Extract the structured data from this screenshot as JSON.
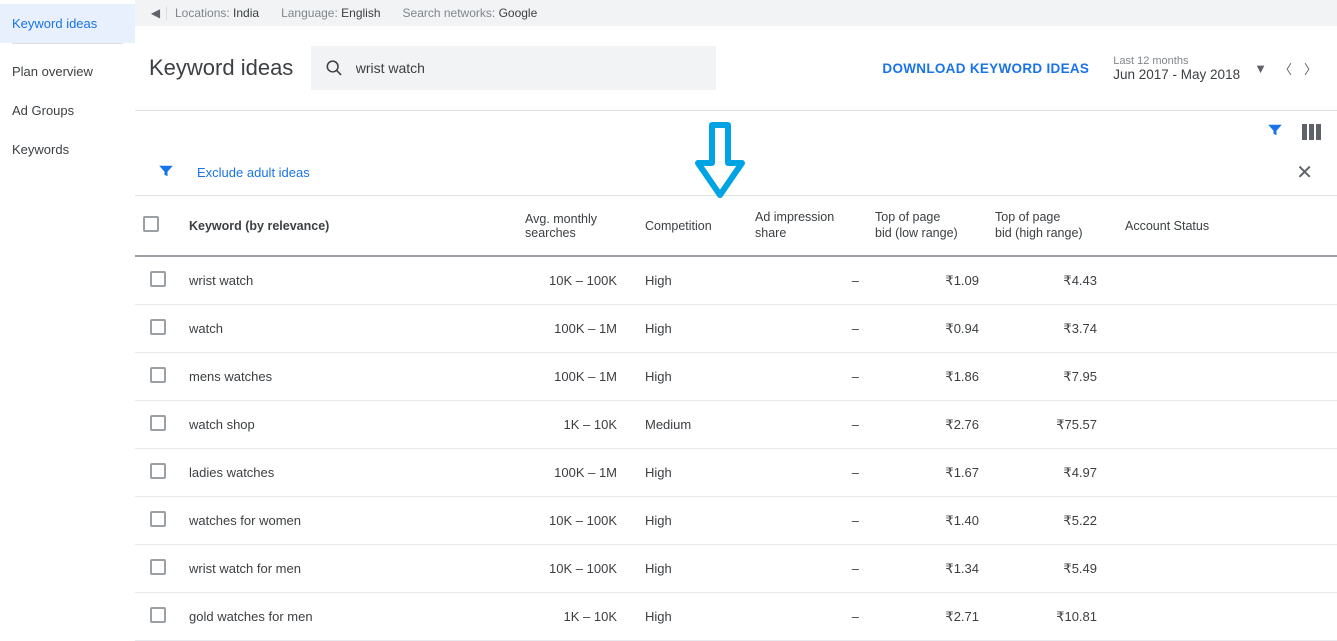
{
  "sidebar": {
    "items": [
      {
        "label": "Keyword ideas"
      },
      {
        "label": "Plan overview"
      },
      {
        "label": "Ad Groups"
      },
      {
        "label": "Keywords"
      }
    ]
  },
  "topbar": {
    "locations_label": "Locations:",
    "locations_value": "India",
    "language_label": "Language:",
    "language_value": "English",
    "networks_label": "Search networks:",
    "networks_value": "Google"
  },
  "header": {
    "title": "Keyword ideas",
    "search_value": "wrist watch",
    "download_label": "DOWNLOAD KEYWORD IDEAS",
    "date_label": "Last 12 months",
    "date_value": "Jun 2017 - May 2018"
  },
  "filters": {
    "exclude_label": "Exclude adult ideas"
  },
  "columns": {
    "keyword": "Keyword (by relevance)",
    "avg_searches": "Avg. monthly searches",
    "competition": "Competition",
    "ad_impression": "Ad impression share",
    "low_bid": "Top of page bid (low range)",
    "high_bid": "Top of page bid (high range)",
    "account_status": "Account Status"
  },
  "rows": [
    {
      "keyword": "wrist watch",
      "searches": "10K – 100K",
      "competition": "High",
      "ad_imp": "–",
      "low": "₹1.09",
      "high": "₹4.43"
    },
    {
      "keyword": "watch",
      "searches": "100K – 1M",
      "competition": "High",
      "ad_imp": "–",
      "low": "₹0.94",
      "high": "₹3.74"
    },
    {
      "keyword": "mens watches",
      "searches": "100K – 1M",
      "competition": "High",
      "ad_imp": "–",
      "low": "₹1.86",
      "high": "₹7.95"
    },
    {
      "keyword": "watch shop",
      "searches": "1K – 10K",
      "competition": "Medium",
      "ad_imp": "–",
      "low": "₹2.76",
      "high": "₹75.57"
    },
    {
      "keyword": "ladies watches",
      "searches": "100K – 1M",
      "competition": "High",
      "ad_imp": "–",
      "low": "₹1.67",
      "high": "₹4.97"
    },
    {
      "keyword": "watches for women",
      "searches": "10K – 100K",
      "competition": "High",
      "ad_imp": "–",
      "low": "₹1.40",
      "high": "₹5.22"
    },
    {
      "keyword": "wrist watch for men",
      "searches": "10K – 100K",
      "competition": "High",
      "ad_imp": "–",
      "low": "₹1.34",
      "high": "₹5.49"
    },
    {
      "keyword": "gold watches for men",
      "searches": "1K – 10K",
      "competition": "High",
      "ad_imp": "–",
      "low": "₹2.71",
      "high": "₹10.81"
    }
  ]
}
